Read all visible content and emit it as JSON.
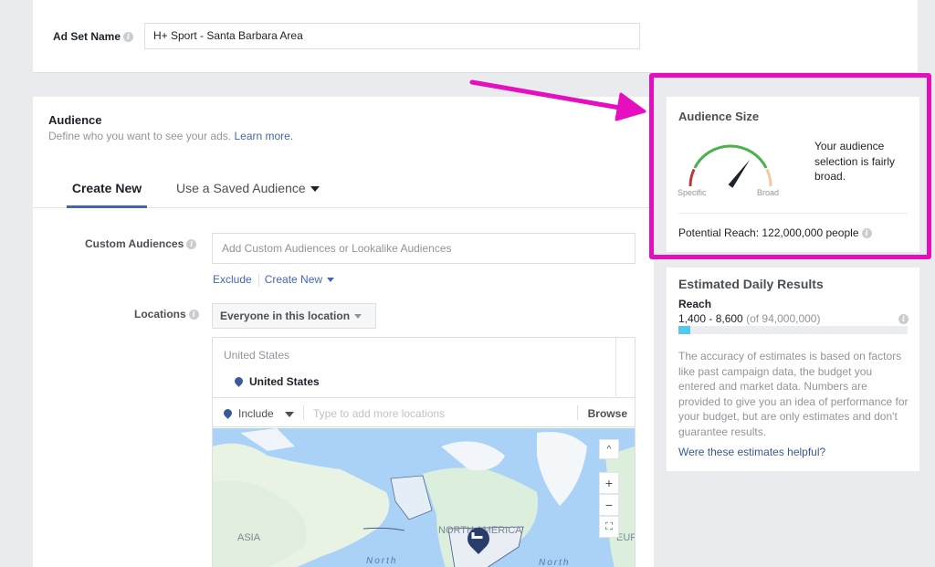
{
  "adset": {
    "label": "Ad Set Name",
    "value": "H+ Sport - Santa Barbara Area"
  },
  "audience": {
    "title": "Audience",
    "subtitle": "Define who you want to see your ads.",
    "learn_more": "Learn more.",
    "tabs": [
      {
        "label": "Create New",
        "active": true
      },
      {
        "label": "Use a Saved Audience",
        "active": false
      }
    ],
    "custom_audiences": {
      "label": "Custom Audiences",
      "placeholder": "Add Custom Audiences or Lookalike Audiences",
      "exclude": "Exclude",
      "create_new": "Create New"
    },
    "locations": {
      "label": "Locations",
      "selected": "Everyone in this location",
      "country_header": "United States",
      "country": "United States",
      "include": "Include",
      "placeholder": "Type to add more locations",
      "browse": "Browse"
    },
    "map": {
      "labels": {
        "asia": "ASIA",
        "north_america": "NORTH AMERICA",
        "europe": "EUR",
        "ocean1": "North",
        "ocean2": "North"
      },
      "controls": {
        "up": "^",
        "zoom_in": "+",
        "zoom_out": "−"
      }
    }
  },
  "audience_size": {
    "title": "Audience Size",
    "gauge_level": 0.7,
    "specific": "Specific",
    "broad": "Broad",
    "description": "Your audience selection is fairly broad.",
    "potential_reach": "Potential Reach: 122,000,000 people",
    "colors": {
      "specific": "#c0363f",
      "middle": "#4cb050",
      "broad": "#f5c7a0",
      "highlight": "#e60fc0"
    }
  },
  "estimated_daily": {
    "title": "Estimated Daily Results",
    "reach_label": "Reach",
    "range": "1,400 - 8,600",
    "of_total": "(of 94,000,000)",
    "progress_fraction": 0.05,
    "note": "The accuracy of estimates is based on factors like past campaign data, the budget you entered and market data. Numbers are provided to give you an idea of performance for your budget, but are only estimates and don't guarantee results.",
    "feedback_link": "Were these estimates helpful?"
  }
}
